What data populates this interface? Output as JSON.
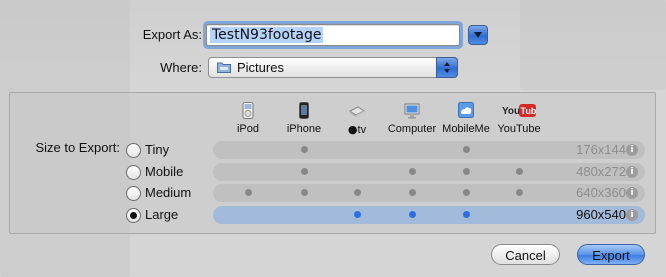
{
  "form": {
    "export_as_label": "Export As:",
    "filename_value": "TestN93footage",
    "where_label": "Where:",
    "where_value": "Pictures"
  },
  "size_section": {
    "label": "Size to Export:",
    "columns": [
      {
        "name": "iPod",
        "icon": "ipod-icon"
      },
      {
        "name": "iPhone",
        "icon": "iphone-icon"
      },
      {
        "name": "tv",
        "icon": "apple-tv-icon"
      },
      {
        "name": "Computer",
        "icon": "computer-icon"
      },
      {
        "name": "MobileMe",
        "icon": "mobileme-icon"
      },
      {
        "name": "YouTube",
        "icon": "youtube-icon"
      }
    ],
    "options": [
      {
        "label": "Tiny",
        "resolution": "176x144",
        "selected": false,
        "compatible": [
          false,
          true,
          false,
          false,
          true,
          false
        ]
      },
      {
        "label": "Mobile",
        "resolution": "480x272",
        "selected": false,
        "compatible": [
          false,
          true,
          false,
          true,
          true,
          true
        ]
      },
      {
        "label": "Medium",
        "resolution": "640x360",
        "selected": false,
        "compatible": [
          true,
          true,
          true,
          true,
          true,
          true
        ]
      },
      {
        "label": "Large",
        "resolution": "960x540",
        "selected": true,
        "compatible": [
          false,
          false,
          true,
          true,
          true,
          false
        ]
      }
    ]
  },
  "buttons": {
    "cancel_label": "Cancel",
    "export_label": "Export"
  },
  "colors": {
    "accent_blue": "#2e6fe0",
    "selected_row": "#8cb0e2",
    "dot_gray": "#888888"
  }
}
